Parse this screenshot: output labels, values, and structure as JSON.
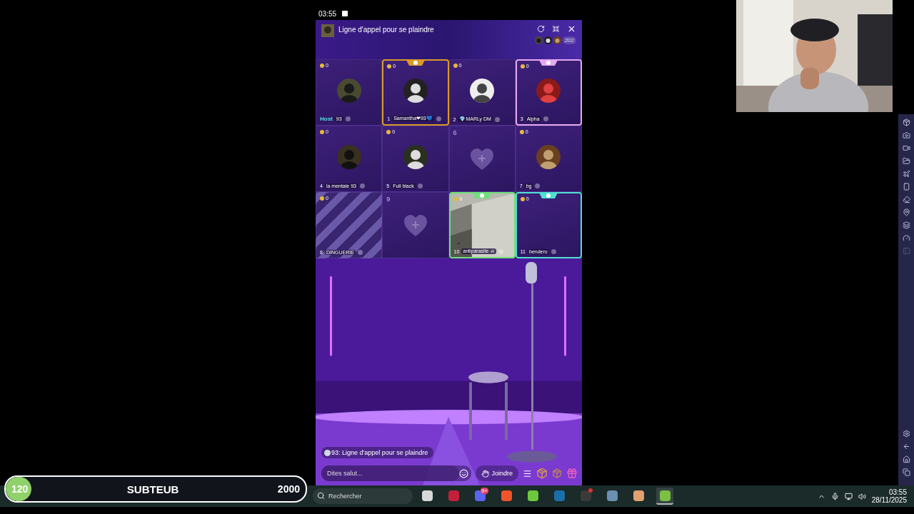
{
  "status_bar": {
    "time": "03:55"
  },
  "room": {
    "title": "Ligne d'appel pour se plaindre",
    "viewer_count": "202"
  },
  "seats": [
    {
      "kind": "occupied",
      "name": "93",
      "coins": "0",
      "badge": "Host"
    },
    {
      "kind": "occupied",
      "number": "1",
      "name": "Samantha❤93💙",
      "coins": "0",
      "color": "#d89a2a"
    },
    {
      "kind": "occupied",
      "number": "2",
      "name": "💎MARLy DM",
      "coins": "0"
    },
    {
      "kind": "occupied",
      "number": "3",
      "name": "Alpha",
      "coins": "0",
      "color": "#e6a8f0"
    },
    {
      "kind": "occupied",
      "number": "4",
      "name": "la mentale 93",
      "coins": "0"
    },
    {
      "kind": "occupied",
      "number": "5",
      "name": "Full black",
      "coins": "0"
    },
    {
      "kind": "empty",
      "number": "6"
    },
    {
      "kind": "occupied",
      "number": "7",
      "name": "bg",
      "coins": "0"
    },
    {
      "kind": "striped",
      "number": "8",
      "name": "DINGUERIE",
      "coins": "0"
    },
    {
      "kind": "empty",
      "number": "9"
    },
    {
      "kind": "video",
      "number": "10",
      "name": "antiparasite ☠",
      "coins": "0",
      "color": "#6ee07a"
    },
    {
      "kind": "blank",
      "number": "11",
      "name": "bendero",
      "coins": "0",
      "color": "#4fe0d0"
    }
  ],
  "chat": {
    "message": "93: Ligne d'appel pour se plaindre"
  },
  "controls": {
    "input_placeholder": "Dites salut...",
    "join_label": "Joindre"
  },
  "goal_bar": {
    "value": "120",
    "label": "SUBTEUB",
    "goal": "2000",
    "level": 0.06
  },
  "taskbar": {
    "search_placeholder": "Rechercher",
    "apps": [
      {
        "color": "#d8d8d8",
        "selected": false
      },
      {
        "color": "#c4203a",
        "selected": false
      },
      {
        "color": "#5865f2",
        "selected": false,
        "badge": "9+"
      },
      {
        "color": "#f0542a",
        "selected": false
      },
      {
        "color": "#6cc93c",
        "selected": false
      },
      {
        "color": "#1b6fa8",
        "selected": false
      },
      {
        "color": "#3a3a3a",
        "selected": false,
        "alert": true
      },
      {
        "color": "#6d8fb0",
        "selected": false
      },
      {
        "color": "#e0a070",
        "selected": false
      },
      {
        "color": "#7bc043",
        "selected": true
      }
    ],
    "time": "03:55",
    "date": "28/11/2025"
  }
}
